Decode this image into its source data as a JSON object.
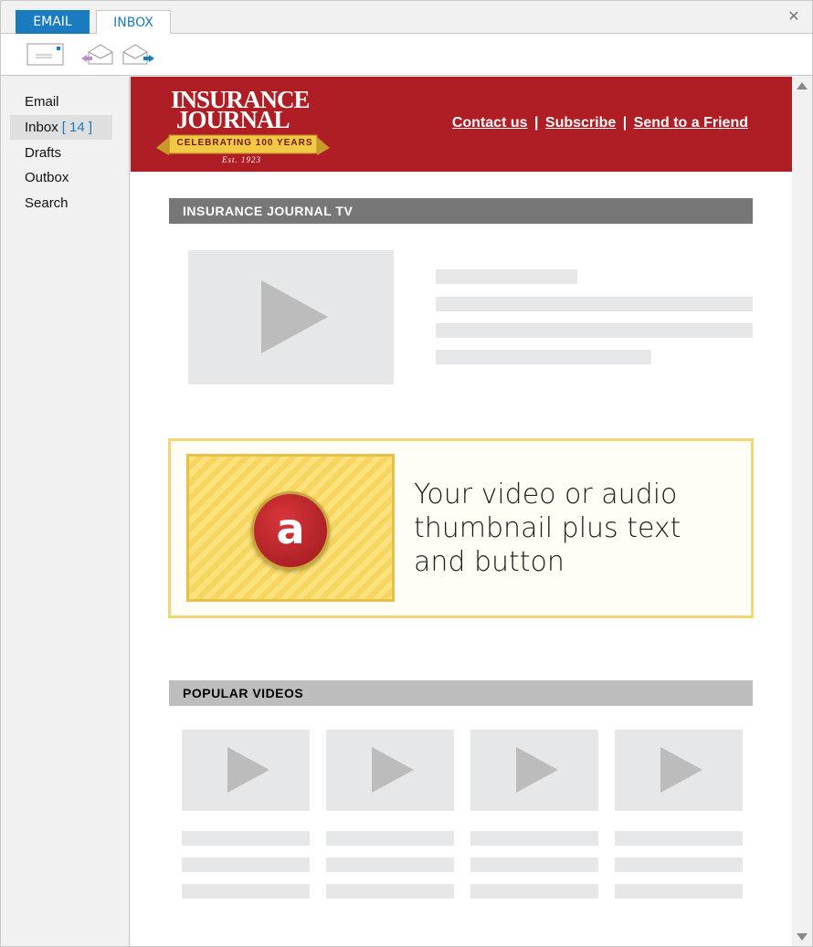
{
  "tabs": [
    {
      "label": "EMAIL"
    },
    {
      "label": "INBOX"
    }
  ],
  "window": {
    "close_glyph": "✕"
  },
  "toolbar": {
    "icons": [
      "envelope-icon",
      "reply-icon",
      "forward-icon"
    ]
  },
  "sidebar": {
    "items": [
      {
        "label": "Email"
      },
      {
        "label": "Inbox",
        "count": "[ 14 ]"
      },
      {
        "label": "Drafts"
      },
      {
        "label": "Outbox"
      },
      {
        "label": "Search"
      }
    ]
  },
  "email": {
    "logo": {
      "line1": "INSURANCE",
      "line2": "JOURNAL",
      "ribbon": "CELEBRATING 100 YEARS",
      "est": "Est. 1923"
    },
    "links": {
      "contact": "Contact us",
      "subscribe": "Subscribe",
      "send_friend": "Send to a Friend",
      "separator": "|"
    },
    "tv_section": {
      "title": "INSURANCE JOURNAL TV"
    },
    "promo": {
      "logo_letter": "a",
      "text": "Your video or audio thumbnail plus text and button"
    },
    "popular_section": {
      "title": "POPULAR VIDEOS"
    }
  },
  "colors": {
    "accent": "#1a7bbf",
    "brand_red": "#b01e25",
    "gold": "#f0d774"
  }
}
